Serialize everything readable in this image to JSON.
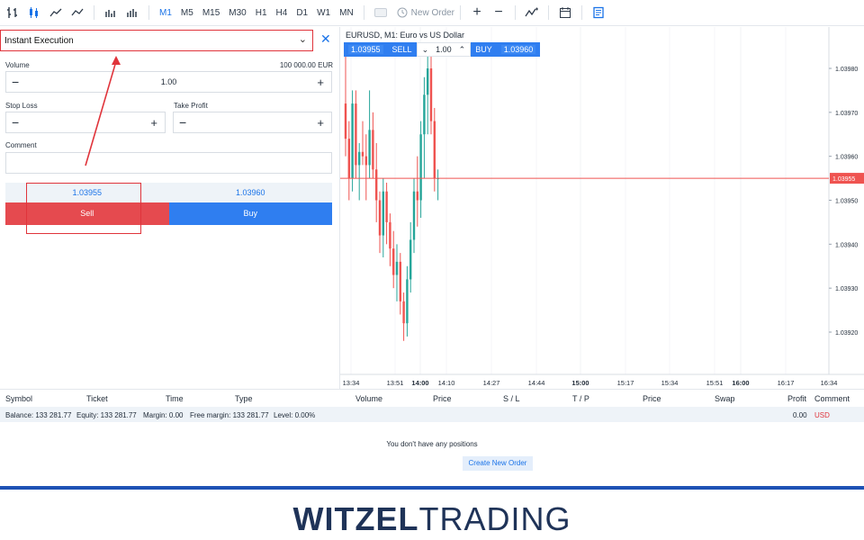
{
  "toolbar": {
    "timeframes": [
      "M1",
      "M5",
      "M15",
      "M30",
      "H1",
      "H4",
      "D1",
      "W1",
      "MN"
    ],
    "active_timeframe": "M1",
    "new_order_label": "New Order"
  },
  "order_panel": {
    "execution_type": "Instant Execution",
    "volume_label": "Volume",
    "volume_value": "1.00",
    "volume_amount": "100 000.00 EUR",
    "stop_loss_label": "Stop Loss",
    "take_profit_label": "Take Profit",
    "comment_label": "Comment",
    "sell_price": "1.03955",
    "buy_price": "1.03960",
    "sell_label": "Sell",
    "buy_label": "Buy"
  },
  "chart": {
    "title": "EURUSD, M1: Euro vs US Dollar",
    "widget": {
      "sell_price": "1.03955",
      "sell_label": "SELL",
      "volume": "1.00",
      "buy_label": "BUY",
      "buy_price": "1.03960"
    },
    "price_axis": [
      "1.03980",
      "1.03970",
      "1.03960",
      "1.03950",
      "1.03940",
      "1.03930",
      "1.03920"
    ],
    "current_price": "1.03955",
    "time_axis": [
      "13:34",
      "13:51",
      "14:00",
      "14:10",
      "14:27",
      "14:44",
      "15:00",
      "15:17",
      "15:34",
      "15:51",
      "16:00",
      "16:17",
      "16:34"
    ],
    "bold_times": [
      "14:00",
      "15:00",
      "16:00"
    ],
    "colors": {
      "bull": "#26a69a",
      "bear": "#ef5350",
      "price_line": "#ef5350"
    }
  },
  "positions": {
    "columns": [
      "Symbol",
      "Ticket",
      "Time",
      "Type",
      "Volume",
      "Price",
      "S / L",
      "T / P",
      "Price",
      "Swap",
      "Profit",
      "Comment"
    ],
    "balance": "Balance: 133 281.77",
    "equity": "Equity: 133 281.77",
    "margin": "Margin: 0.00",
    "free_margin": "Free margin: 133 281.77",
    "level": "Level: 0.00%",
    "profit_total": "0.00",
    "currency": "USD",
    "empty_message": "You don't have any positions",
    "create_button": "Create New Order"
  },
  "brand": {
    "part1": "WITZEL",
    "part2": "TRADING"
  },
  "colors": {
    "accent": "#1a73e8",
    "sell": "#e54a4f",
    "buy": "#2f7ef0",
    "highlight": "#e0343b"
  }
}
